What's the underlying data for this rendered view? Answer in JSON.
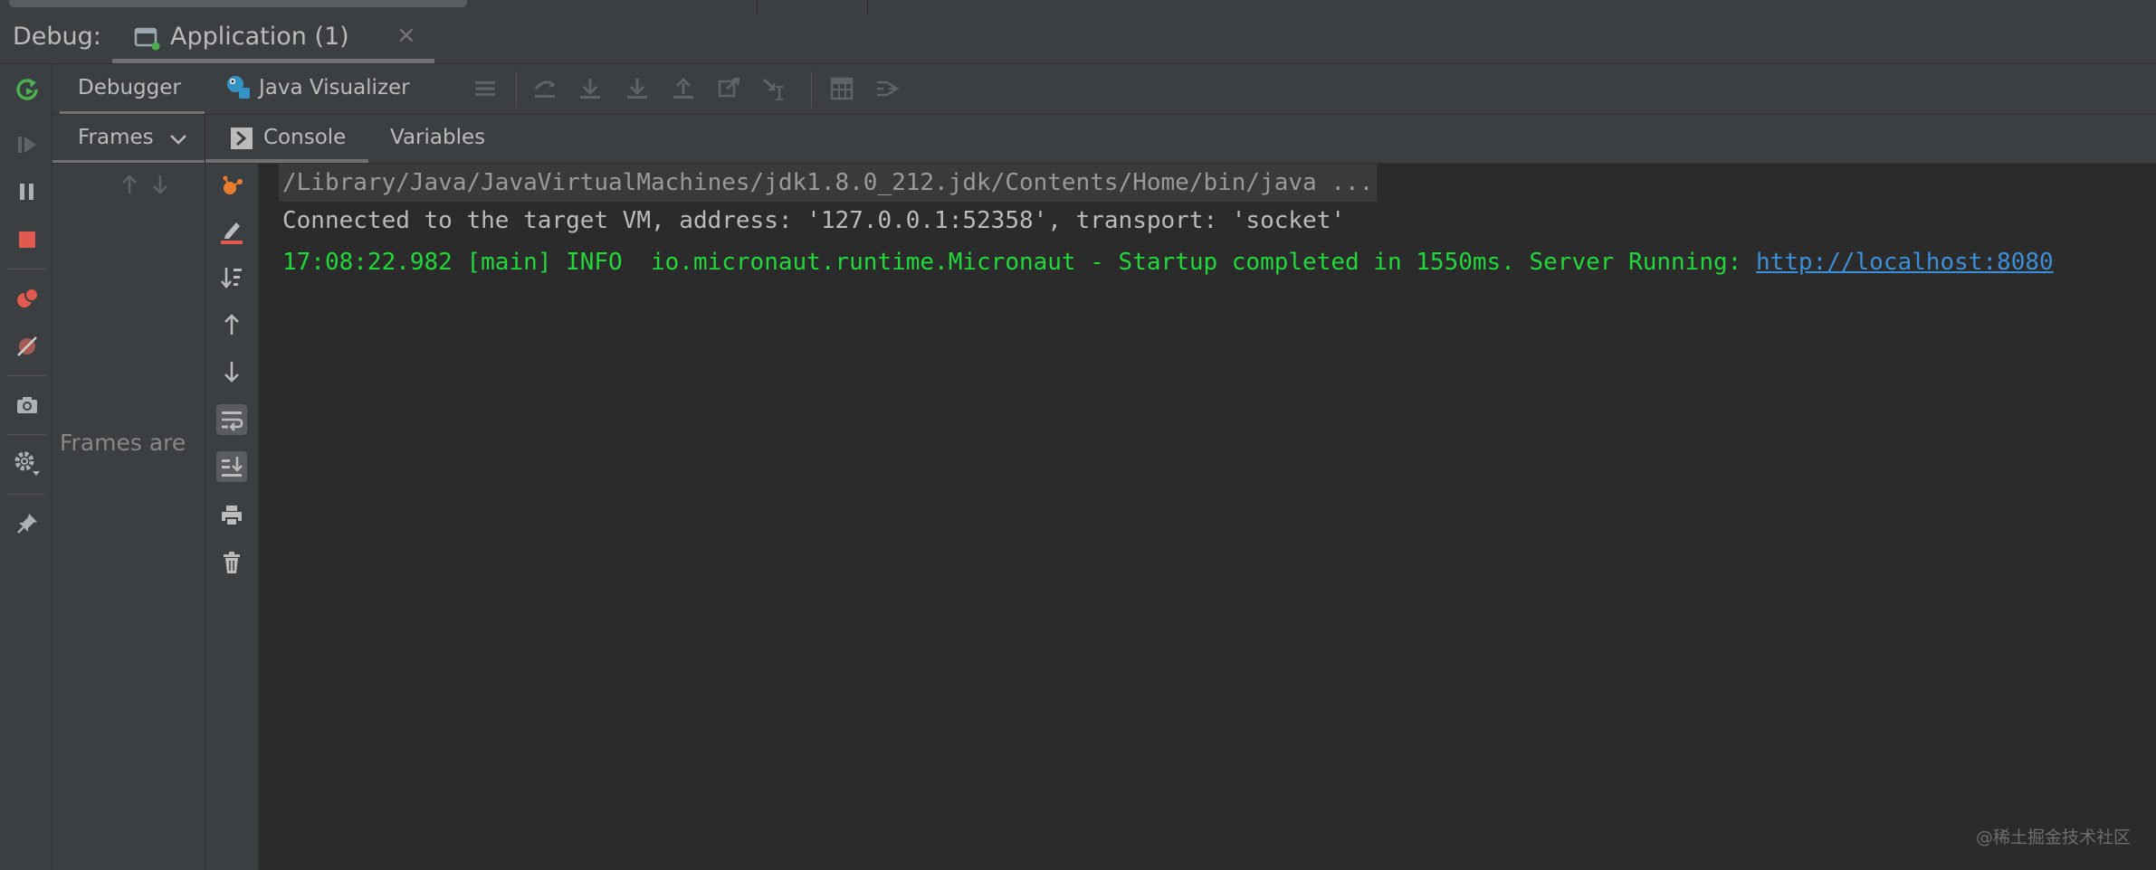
{
  "debug_panel": {
    "label": "Debug:",
    "run_tab": {
      "label": "Application (1)",
      "close_glyph": "×"
    }
  },
  "toolbar": {
    "tabs": [
      {
        "label": "Debugger"
      },
      {
        "label": "Java Visualizer"
      }
    ]
  },
  "frames": {
    "header": "Frames",
    "empty_text": "Frames are"
  },
  "console_tabs": [
    {
      "label": "Console"
    },
    {
      "label": "Variables"
    }
  ],
  "console": {
    "command_line": "/Library/Java/JavaVirtualMachines/jdk1.8.0_212.jdk/Contents/Home/bin/java ...",
    "connected_line": "Connected to the target VM, address: '127.0.0.1:52358', transport: 'socket'",
    "info_line_prefix": "17:08:22.982 [main] INFO  io.micronaut.runtime.Micronaut - Startup completed in 1550ms. Server Running: ",
    "info_line_link": "http://localhost:8080"
  },
  "watermark": "@稀土掘金技术社区",
  "colors": {
    "panel_bg": "#3c3f41",
    "console_bg": "#2b2b2b",
    "info_text": "#22d83a",
    "link": "#3d8fd8",
    "rerun_green": "#4caf50",
    "stop_red": "#e05a4f"
  }
}
